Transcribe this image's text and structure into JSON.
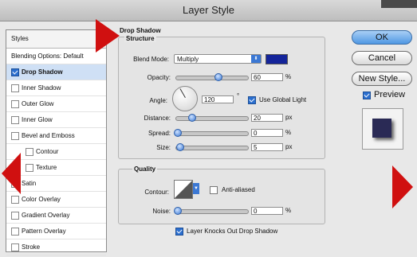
{
  "window": {
    "title": "Layer Style"
  },
  "styles_panel": {
    "header": "Styles",
    "blending_options": "Blending Options: Default",
    "items": [
      {
        "label": "Drop Shadow",
        "checked": true,
        "selected": true
      },
      {
        "label": "Inner Shadow",
        "checked": false
      },
      {
        "label": "Outer Glow",
        "checked": false
      },
      {
        "label": "Inner Glow",
        "checked": false
      },
      {
        "label": "Bevel and Emboss",
        "checked": false
      },
      {
        "label": "Contour",
        "checked": false,
        "indent": true
      },
      {
        "label": "Texture",
        "checked": false,
        "indent": true
      },
      {
        "label": "Satin",
        "checked": false
      },
      {
        "label": "Color Overlay",
        "checked": false
      },
      {
        "label": "Gradient Overlay",
        "checked": false
      },
      {
        "label": "Pattern Overlay",
        "checked": false
      },
      {
        "label": "Stroke",
        "checked": false
      }
    ]
  },
  "drop_shadow": {
    "title": "Drop Shadow",
    "structure_title": "Structure",
    "blend_mode_label": "Blend Mode:",
    "blend_mode_value": "Multiply",
    "shadow_color": "#14249a",
    "opacity_label": "Opacity:",
    "opacity_value": "60",
    "opacity_unit": "%",
    "opacity_level": 0.6,
    "angle_label": "Angle:",
    "angle_value": "120",
    "angle_unit": "°",
    "use_global_light_label": "Use Global Light",
    "use_global_light_checked": true,
    "distance_label": "Distance:",
    "distance_value": "20",
    "distance_unit": "px",
    "spread_label": "Spread:",
    "spread_value": "0",
    "spread_unit": "%",
    "size_label": "Size:",
    "size_value": "5",
    "size_unit": "px",
    "quality_title": "Quality",
    "contour_label": "Contour:",
    "anti_aliased_label": "Anti-aliased",
    "anti_aliased_checked": false,
    "noise_label": "Noise:",
    "noise_value": "0",
    "noise_unit": "%",
    "knockout_label": "Layer Knocks Out Drop Shadow",
    "knockout_checked": true
  },
  "buttons": {
    "ok": "OK",
    "cancel": "Cancel",
    "new_style": "New Style...",
    "preview_label": "Preview",
    "preview_checked": true
  },
  "colors": {
    "annotation_arrow": "#d01010",
    "selection": "#cfe0f5",
    "accent": "#3b78d4"
  }
}
